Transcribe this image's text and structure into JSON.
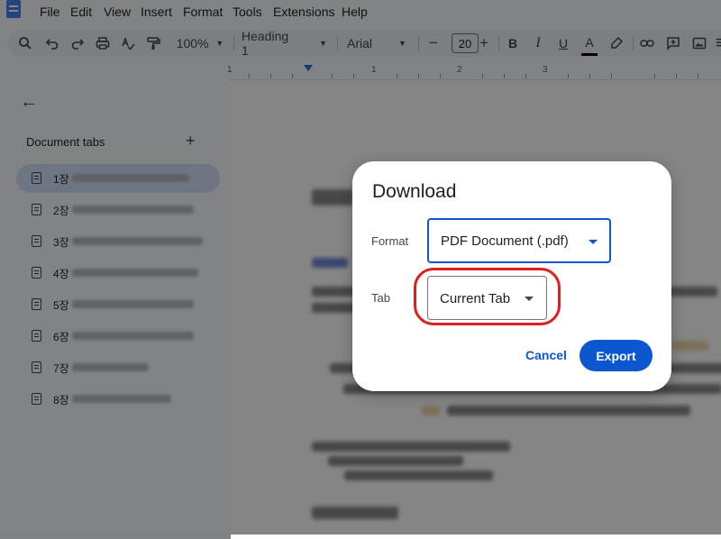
{
  "menu": {
    "items": [
      "File",
      "Edit",
      "View",
      "Insert",
      "Format",
      "Tools",
      "Extensions",
      "Help"
    ]
  },
  "toolbar": {
    "zoom": "100%",
    "style": "Heading 1",
    "font": "Arial",
    "font_size": "20",
    "minus": "−",
    "plus": "+",
    "bold": "B",
    "italic": "I",
    "underline": "U",
    "text_color": "A"
  },
  "ruler": {
    "numbers": [
      "1",
      "1",
      "2",
      "3"
    ]
  },
  "sidebar": {
    "title": "Document tabs",
    "add": "+",
    "tabs": [
      {
        "label": "1장",
        "active": true
      },
      {
        "label": "2장",
        "active": false
      },
      {
        "label": "3장",
        "active": false
      },
      {
        "label": "4장",
        "active": false
      },
      {
        "label": "5장",
        "active": false
      },
      {
        "label": "6장",
        "active": false
      },
      {
        "label": "7장",
        "active": false
      },
      {
        "label": "8장",
        "active": false
      }
    ]
  },
  "dialog": {
    "title": "Download",
    "format_label": "Format",
    "format_value": "PDF Document (.pdf)",
    "tab_label": "Tab",
    "tab_value": "Current Tab",
    "cancel": "Cancel",
    "export": "Export"
  },
  "colors": {
    "accent": "#0b57d0",
    "highlight_ring": "#e01e1e",
    "active_tab": "#d3e3fd"
  }
}
